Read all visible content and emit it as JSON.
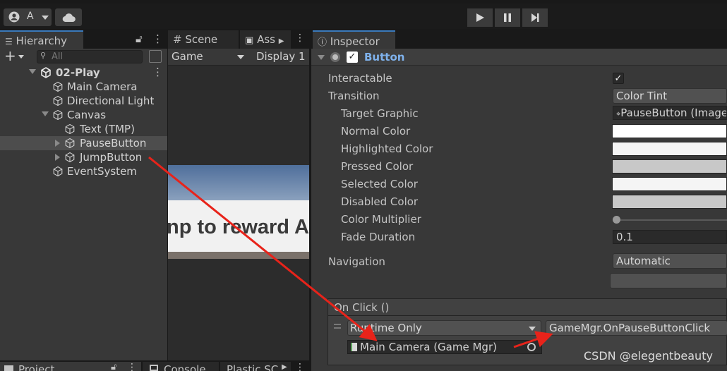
{
  "toolbar": {
    "account_label": "A",
    "account_icon": "account-icon",
    "cloud_icon": "cloud-icon",
    "play_icon": "play-icon",
    "pause_icon": "pause-icon",
    "step_icon": "step-icon"
  },
  "hierarchy": {
    "tab_label": "Hierarchy",
    "search_placeholder": "All",
    "scene_name": "02-Play",
    "items": [
      {
        "label": "Main Camera"
      },
      {
        "label": "Directional Light"
      },
      {
        "label": "Canvas"
      },
      {
        "label": "Text (TMP)"
      },
      {
        "label": "PauseButton"
      },
      {
        "label": "JumpButton"
      },
      {
        "label": "EventSystem"
      }
    ]
  },
  "scene_panel": {
    "tab_scene": "Scene",
    "tab_assets": "Ass",
    "game_dropdown": "Game",
    "display_dropdown": "Display 1",
    "game_text": "np to reward A"
  },
  "inspector": {
    "tab_label": "Inspector",
    "component_name": "Button",
    "interactable_label": "Interactable",
    "transition_label": "Transition",
    "transition_value": "Color Tint",
    "target_graphic_label": "Target Graphic",
    "target_graphic_value": "PauseButton (Image",
    "normal_color_label": "Normal Color",
    "highlighted_color_label": "Highlighted Color",
    "pressed_color_label": "Pressed Color",
    "selected_color_label": "Selected Color",
    "disabled_color_label": "Disabled Color",
    "color_multiplier_label": "Color Multiplier",
    "fade_duration_label": "Fade Duration",
    "fade_duration_value": "0.1",
    "navigation_label": "Navigation",
    "navigation_value": "Automatic",
    "on_click_label": "On Click ()",
    "runtime_value": "Runtime Only",
    "function_value": "GameMgr.OnPauseButtonClick",
    "object_value": "Main Camera (Game Mgr)"
  },
  "bottom": {
    "project_tab": "Project",
    "console_tab": "Console",
    "plastic_tab": "Plastic SC"
  },
  "watermark": "CSDN @elegentbeauty",
  "colors": {
    "accent": "#3a79bb",
    "annotation_red": "#e8231a",
    "component_name": "#7fb2ec"
  }
}
